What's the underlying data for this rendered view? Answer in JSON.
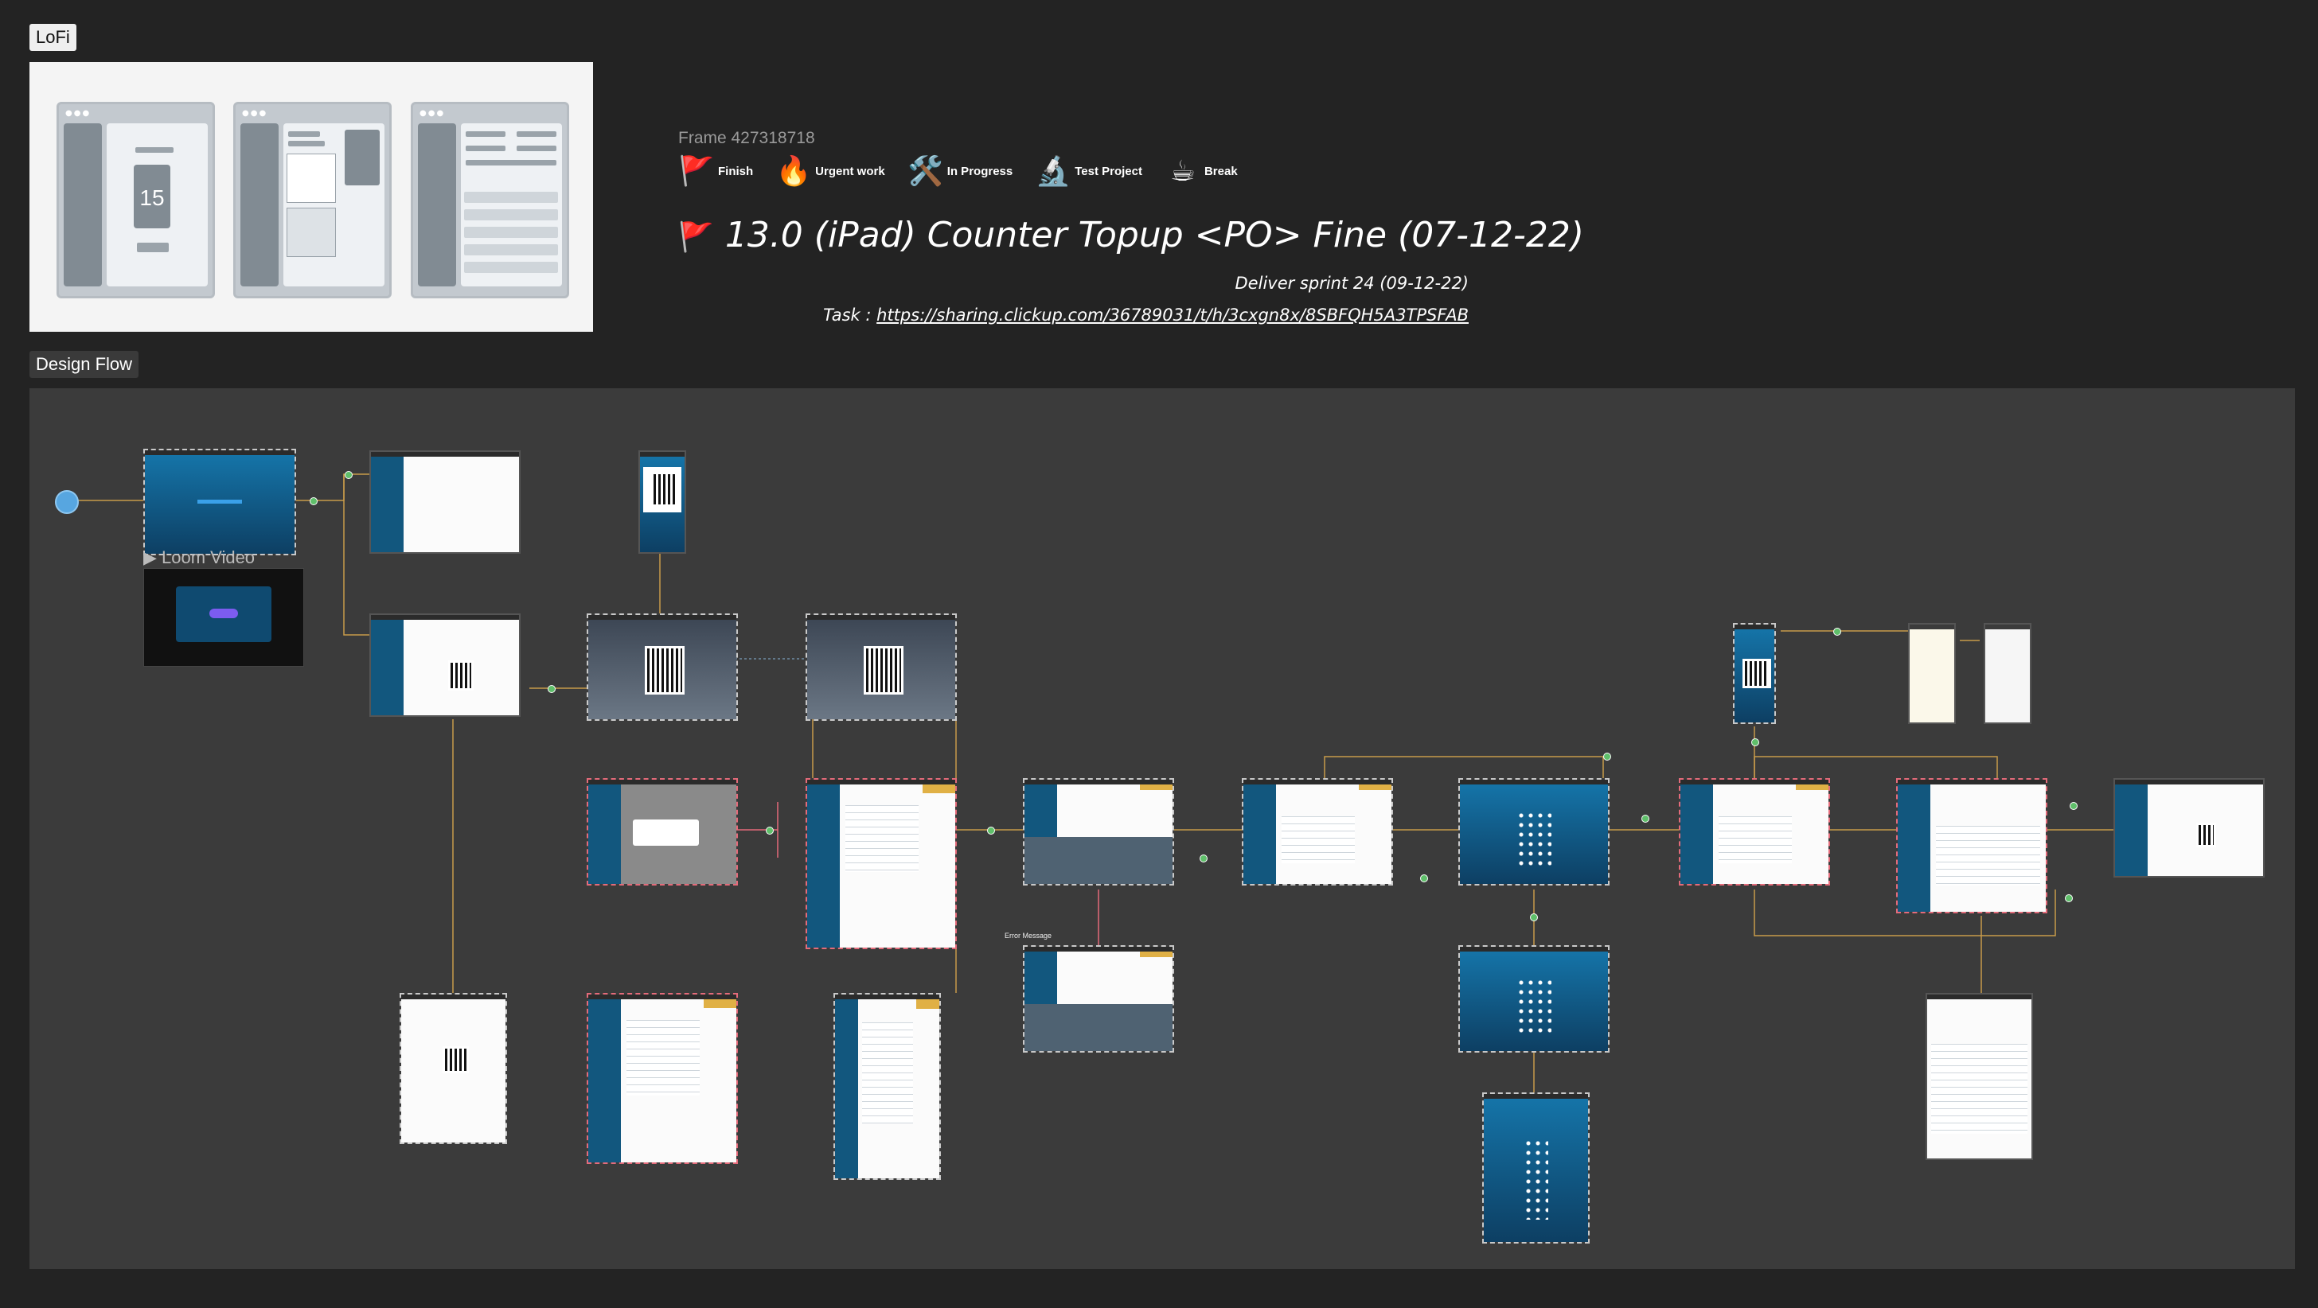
{
  "sections": {
    "lofi_label": "LoFi",
    "design_flow_label": "Design Flow"
  },
  "lofi": {
    "number": "15"
  },
  "frame_label": "Frame 427318718",
  "legend": [
    {
      "icon": "red-flag-icon",
      "emoji": "🚩",
      "label": "Finish"
    },
    {
      "icon": "fire-icon",
      "emoji": "🔥",
      "label": "Urgent work"
    },
    {
      "icon": "tools-icon",
      "emoji": "🛠️",
      "label": "In Progress"
    },
    {
      "icon": "microscope-icon",
      "emoji": "🔬",
      "label": "Test Project"
    },
    {
      "icon": "coffee-icon",
      "emoji": "☕",
      "label": "Break"
    }
  ],
  "title": {
    "flag": "🚩",
    "text": "13.0 (iPad) Counter Topup <PO> Fine (07-12-22)"
  },
  "subtitle": "Deliver sprint 24 (09-12-22)",
  "task": {
    "prefix": "Task : ",
    "link": "https://sharing.clickup.com/36789031/t/h/3cxgn8x/8SBFQH5A3TPSFAB"
  },
  "flow": {
    "loom_label": "Loom Video",
    "error_label": "Error Message",
    "screens": [
      {
        "id": "login",
        "type": "blue"
      },
      {
        "id": "home",
        "type": "app"
      },
      {
        "id": "mobile-qr",
        "type": "blue"
      },
      {
        "id": "topup-qr-form",
        "type": "app"
      },
      {
        "id": "qr-photo-1",
        "type": "photo"
      },
      {
        "id": "qr-photo-2",
        "type": "photo"
      },
      {
        "id": "dialog",
        "type": "app"
      },
      {
        "id": "form-detail",
        "type": "app"
      },
      {
        "id": "keyboard-form",
        "type": "app"
      },
      {
        "id": "form-filled",
        "type": "app"
      },
      {
        "id": "pin-pad",
        "type": "blue"
      },
      {
        "id": "result-form",
        "type": "app"
      },
      {
        "id": "table-list",
        "type": "app"
      },
      {
        "id": "receipt",
        "type": "app"
      },
      {
        "id": "receipt-mobile",
        "type": "blue"
      },
      {
        "id": "slip-1",
        "type": "app"
      },
      {
        "id": "slip-2",
        "type": "app"
      },
      {
        "id": "qr-print-mobile",
        "type": "app"
      },
      {
        "id": "form-portrait-1",
        "type": "app"
      },
      {
        "id": "form-portrait-2",
        "type": "app"
      },
      {
        "id": "keyboard-error",
        "type": "app"
      },
      {
        "id": "pin-pad-2",
        "type": "blue"
      },
      {
        "id": "pin-pad-portrait",
        "type": "blue"
      },
      {
        "id": "table-portrait",
        "type": "app"
      }
    ]
  },
  "colors": {
    "background": "#232323",
    "flow_background": "#3b3b3b",
    "connector": "#c89b4a",
    "error_connector": "#e46b7a",
    "start_node": "#57a6e0"
  }
}
